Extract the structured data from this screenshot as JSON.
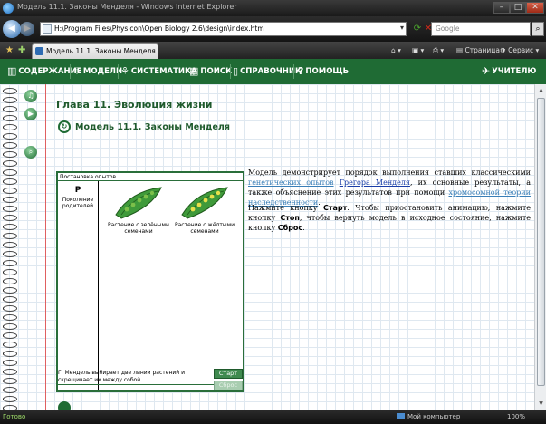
{
  "window": {
    "title": "Модель 11.1. Законы Менделя - Windows Internet Explorer",
    "min": "–",
    "max": "□",
    "close": "✕"
  },
  "address": {
    "url": "H:\\Program Files\\Physicon\\Open Biology 2.6\\design\\index.htm",
    "search_placeholder": "Google"
  },
  "tab": {
    "label": "Модель 11.1. Законы Менделя"
  },
  "commands": {
    "page": "Страница",
    "service": "Сервис"
  },
  "app_nav": {
    "items": [
      {
        "label": "СОДЕРЖАНИЕ",
        "icon": "book-icon"
      },
      {
        "label": "МОДЕЛИ",
        "icon": "models-icon"
      },
      {
        "label": "СИСТЕМАТИКА",
        "icon": "systematics-icon"
      },
      {
        "label": "ПОИСК",
        "icon": "search-icon"
      },
      {
        "label": "СПРАВОЧНИК",
        "icon": "reference-icon"
      },
      {
        "label": "ПОМОЩЬ",
        "icon": "help-icon"
      }
    ],
    "teacher": "УЧИТЕЛЮ"
  },
  "chapter": "Глава 11. Эволюция жизни",
  "model_title": "Модель 11.1.  Законы Менделя",
  "sim": {
    "header": "Постановка опытов",
    "gen_letter": "P",
    "gen_label": "Поколение родителей",
    "plant_green": "Растение с зелёными семенами",
    "plant_yellow": "Растение с жёлтыми семенами",
    "message": "Г. Мендель выбирает две линии растений и скрещивает их между собой",
    "start": "Старт",
    "reset": "Сброс",
    "colors": {
      "frame": "#2a6e3a",
      "pod": "#3f9a3a",
      "yellow_seed": "#e8e04a",
      "green_seed": "#7cc04a"
    }
  },
  "description": {
    "p1_a": "Модель демонстрирует порядок выполнения ставших классическими ",
    "p1_link1": "генетических опытов",
    "p1_b": " ",
    "p1_link2": "Грегора Менделя",
    "p1_c": ", их основные результаты, а также объяснение этих результатов при помощи ",
    "p1_link3": "хромосомной теории наследственности",
    "p1_d": ".",
    "p2_a": "Нажмите кнопку ",
    "p2_start": "Старт",
    "p2_b": ". Чтобы приостановить анимацию, нажмите кнопку ",
    "p2_stop": "Стоп",
    "p2_c": ", чтобы вернуть модель в исходное состояние, нажмите кнопку ",
    "p2_reset": "Сброс",
    "p2_d": "."
  },
  "status": {
    "text": "Готово",
    "zone": "Мой компьютер",
    "zoom": "100%"
  }
}
